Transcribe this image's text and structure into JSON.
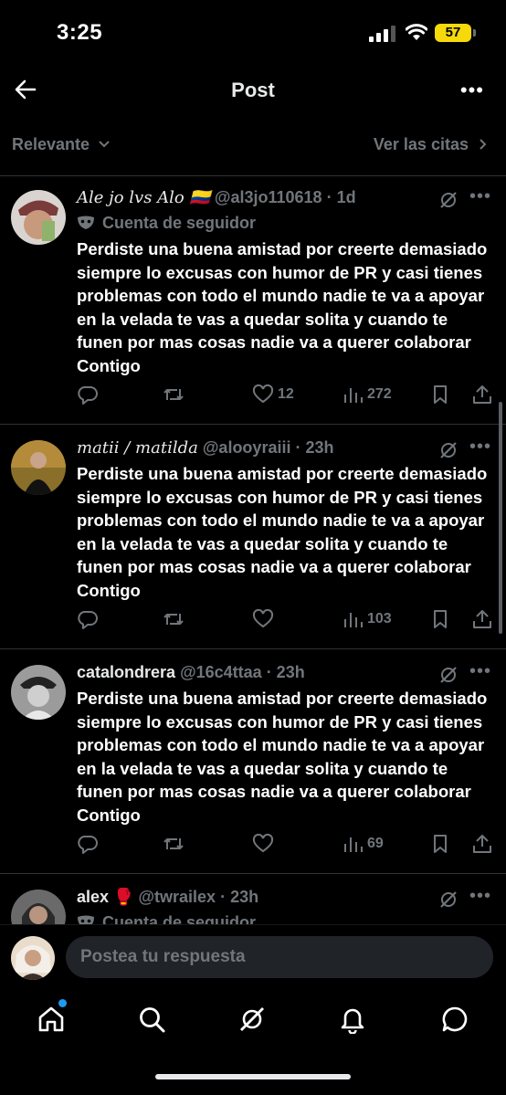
{
  "status_bar": {
    "time": "3:25",
    "battery": "57"
  },
  "header": {
    "title": "Post"
  },
  "filter": {
    "sort_label": "Relevante",
    "quotes_label": "Ver las citas"
  },
  "posts": [
    {
      "name": "Ale jo lvs Alo 🇨🇴",
      "handle": "@al3jo110618",
      "time": "· 1d",
      "badge": "Cuenta de seguidor",
      "text": "Perdiste una buena amistad por creerte demasiado siempre lo excusas con humor de PR y casi tienes problemas con todo el mundo nadie te va a apoyar en la velada te vas a quedar solita y cuando te funen por mas cosas nadie va a querer colaborar Contigo",
      "likes": "12",
      "views": "272"
    },
    {
      "name": "matii / matilda",
      "handle": "@alooyraiii",
      "time": "· 23h",
      "text": "Perdiste una buena amistad por creerte demasiado siempre lo excusas con humor de PR y casi tienes problemas con todo el mundo nadie te va a apoyar en la velada te vas a quedar solita y cuando te funen por mas cosas nadie va a querer colaborar Contigo",
      "views": "103"
    },
    {
      "name": "catalondrera",
      "handle": "@16c4ttaa",
      "time": "· 23h",
      "text": "Perdiste una buena amistad por creerte demasiado siempre lo excusas con humor de PR y casi tienes problemas con todo el mundo nadie te va a apoyar en la velada te vas a quedar solita y cuando te funen por mas cosas nadie va a querer colaborar Contigo",
      "views": "69"
    },
    {
      "name": "alex 🥊",
      "handle": "@twrailex",
      "time": "· 23h",
      "badge": "Cuenta de seguidor"
    }
  ],
  "reply": {
    "placeholder": "Postea tu respuesta"
  },
  "icons": {
    "back": "arrow-left-icon",
    "more": "more-icon",
    "grok": "grok-icon",
    "reply": "reply-icon",
    "repost": "repost-icon",
    "like": "heart-icon",
    "views": "views-icon",
    "bookmark": "bookmark-icon",
    "share": "share-icon",
    "home": "home-icon",
    "search": "search-icon",
    "notifications": "bell-icon",
    "messages": "messages-icon"
  },
  "colors": {
    "background": "#000000",
    "text": "#e7e9ea",
    "muted": "#71767b",
    "accent": "#1d9bf0",
    "battery": "#f5d90a"
  }
}
